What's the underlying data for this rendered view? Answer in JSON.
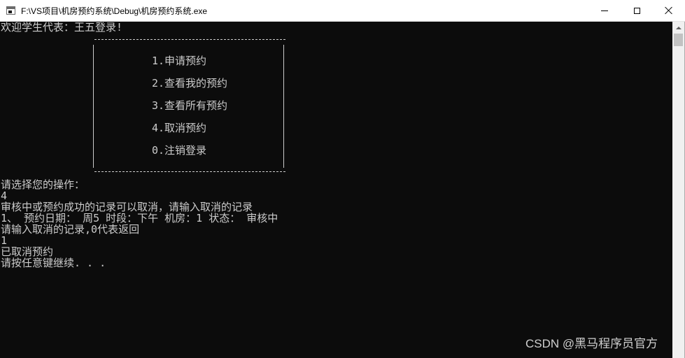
{
  "window": {
    "title": "F:\\VS项目\\机房预约系统\\Debug\\机房预约系统.exe"
  },
  "console": {
    "welcome": "欢迎学生代表：王五登录!",
    "menu_top_border": "------------------------------------",
    "menu": [
      {
        "label": "1.申请预约"
      },
      {
        "label": "2.查看我的预约"
      },
      {
        "label": "3.查看所有预约"
      },
      {
        "label": "4.取消预约"
      },
      {
        "label": "0.注销登录"
      }
    ],
    "menu_bottom_border": "------------------------------------",
    "lines": [
      "请选择您的操作：",
      "4",
      "审核中或预约成功的记录可以取消，请输入取消的记录",
      "1、 预约日期： 周5 时段：下午 机房：1 状态： 审核中",
      "请输入取消的记录,0代表返回",
      "1",
      "已取消预约",
      "请按任意键继续. . ."
    ]
  },
  "watermark": "CSDN @黑马程序员官方",
  "icons": {
    "app": "console-app-icon",
    "minimize": "minimize-icon",
    "maximize": "maximize-icon",
    "close": "close-icon",
    "scroll_up": "scroll-up-arrow-icon"
  },
  "colors": {
    "console_background": "#0c0c0c",
    "console_text": "#cccccc",
    "titlebar_background": "#ffffff"
  }
}
